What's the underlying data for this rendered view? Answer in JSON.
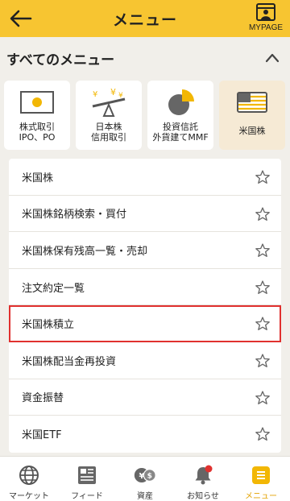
{
  "header": {
    "title": "メニュー",
    "mypage_label": "MYPAGE"
  },
  "section": {
    "title": "すべてのメニュー"
  },
  "tiles": [
    {
      "label": "株式取引\nIPO、PO",
      "icon": "stock-icon"
    },
    {
      "label": "日本株\n信用取引",
      "icon": "margin-scale-icon"
    },
    {
      "label": "投資信託\n外貨建てMMF",
      "icon": "pie-chart-icon"
    },
    {
      "label": "米国株",
      "icon": "us-flag-icon",
      "active": true
    }
  ],
  "list": [
    {
      "label": "米国株"
    },
    {
      "label": "米国株銘柄検索・買付"
    },
    {
      "label": "米国株保有残高一覧・売却"
    },
    {
      "label": "注文約定一覧"
    },
    {
      "label": "米国株積立",
      "highlighted": true
    },
    {
      "label": "米国株配当金再投資"
    },
    {
      "label": "資金振替"
    },
    {
      "label": "米国ETF"
    }
  ],
  "bottom_nav": [
    {
      "label": "マーケット",
      "icon": "globe-icon"
    },
    {
      "label": "フィード",
      "icon": "newspaper-icon"
    },
    {
      "label": "資産",
      "icon": "assets-icon"
    },
    {
      "label": "お知らせ",
      "icon": "bell-icon",
      "has_notification": true
    },
    {
      "label": "メニュー",
      "icon": "menu-icon",
      "active": true
    }
  ],
  "colors": {
    "header_bg": "#f7c531",
    "accent": "#f2b705",
    "highlight_border": "#e0312f",
    "active_tile_bg": "#f6ead5"
  }
}
